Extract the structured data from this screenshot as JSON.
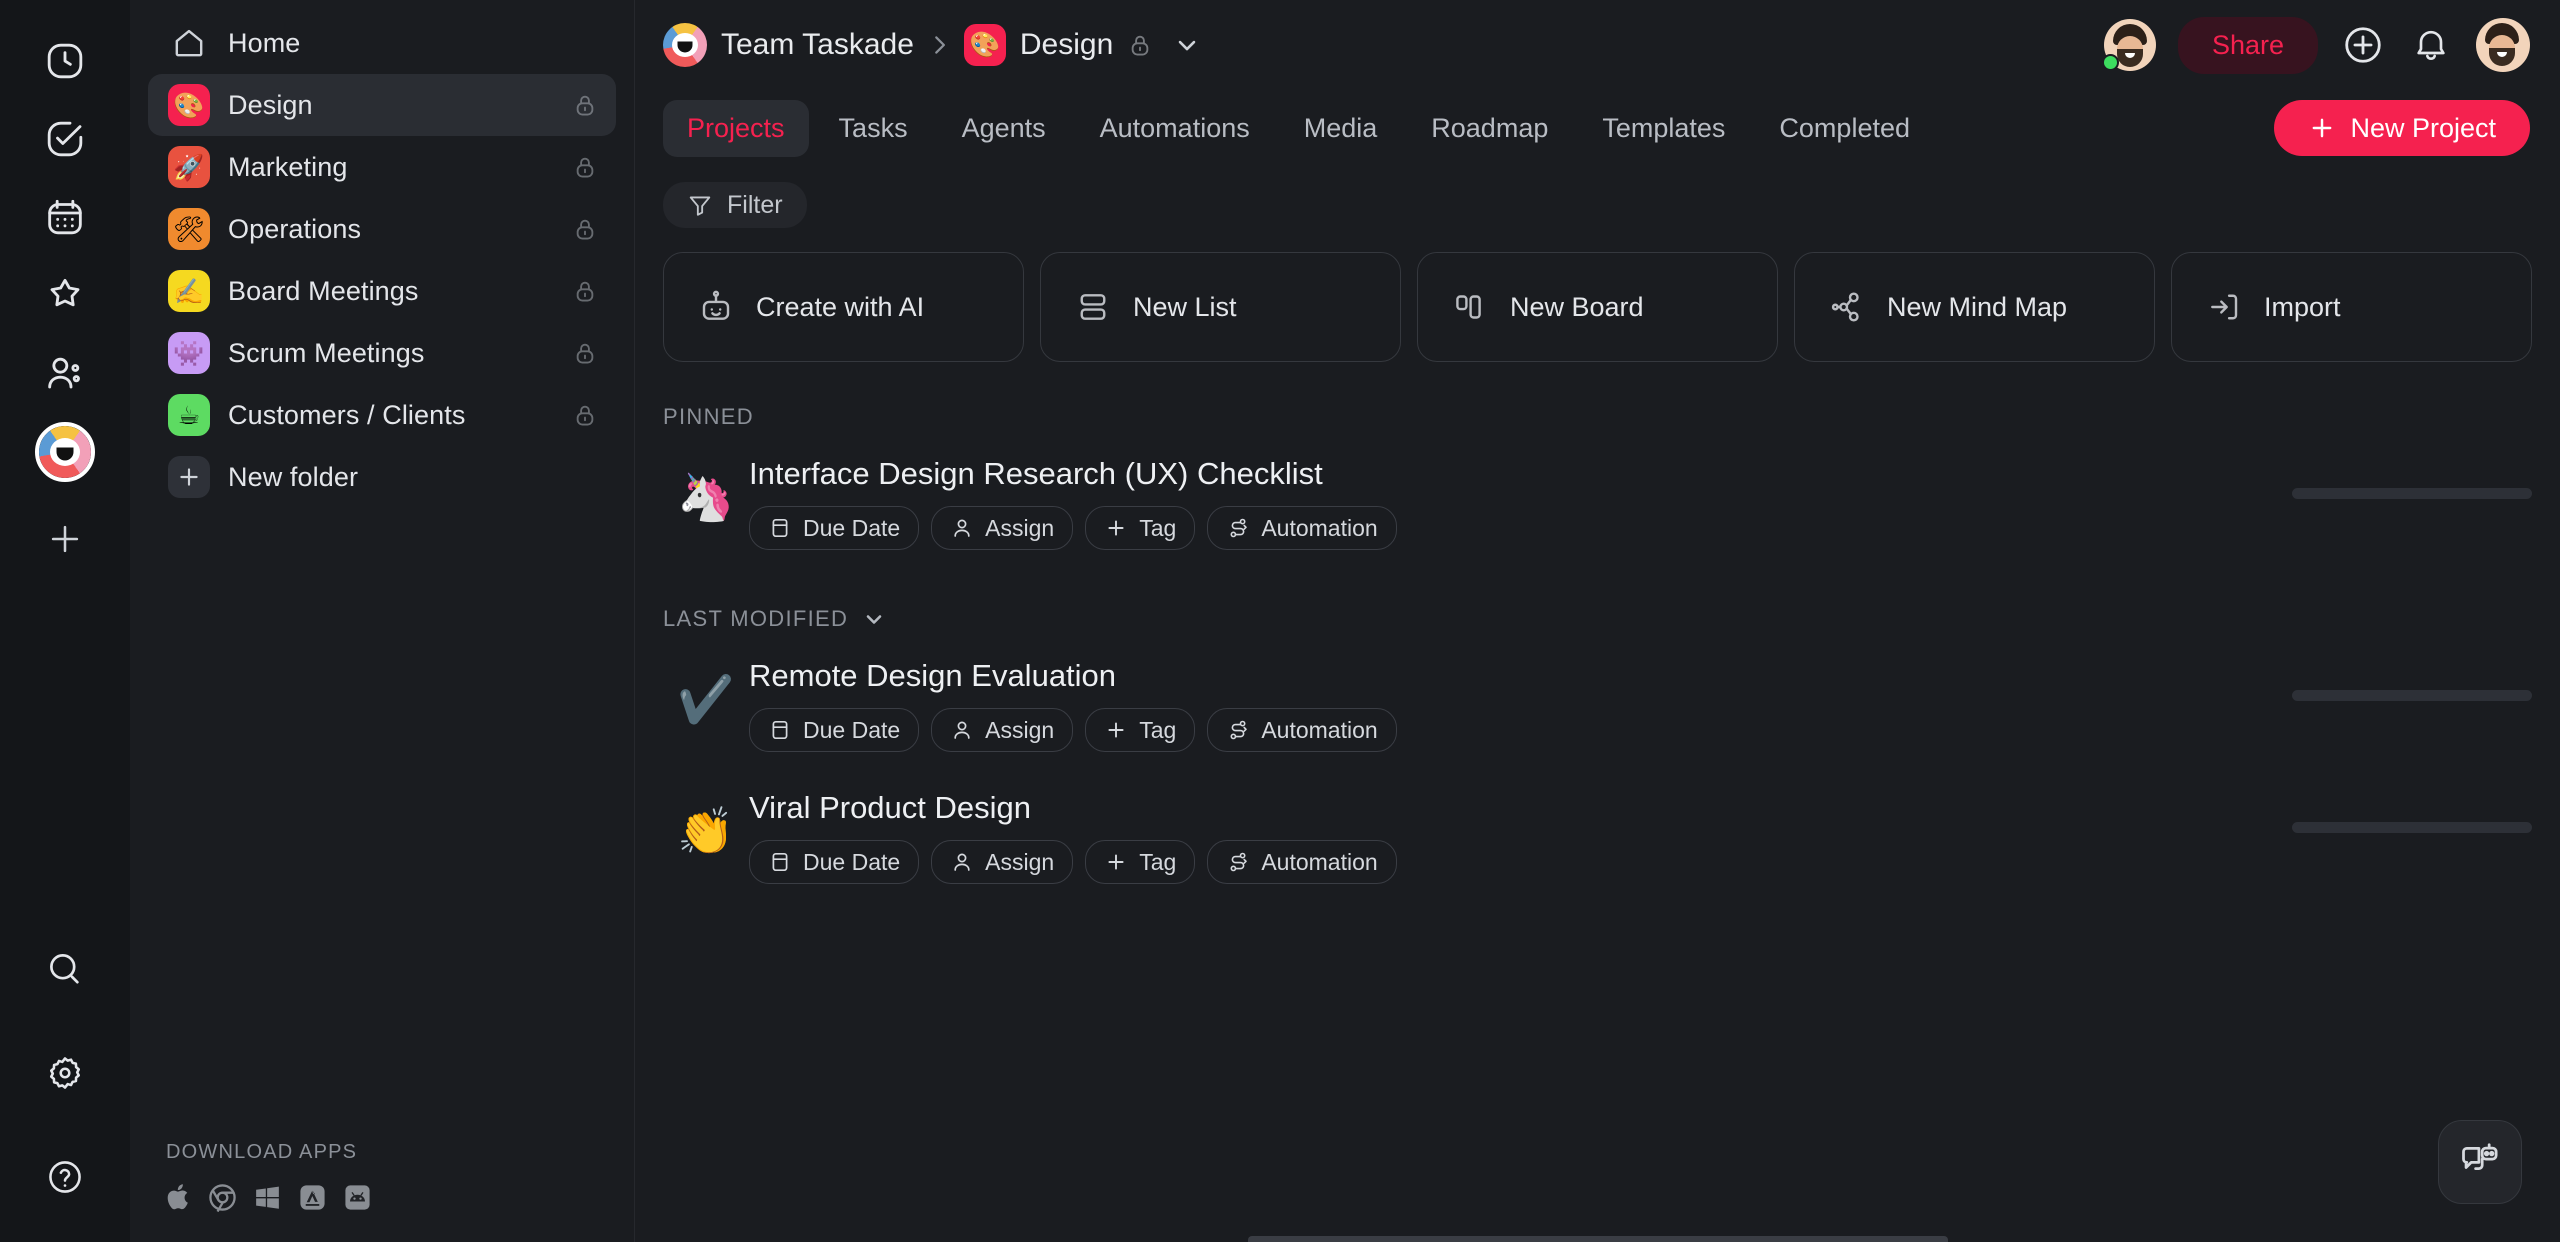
{
  "colors": {
    "accent": "#f5214f",
    "bg": "#1a1c20",
    "rail_bg": "#141619",
    "panel_active": "#2a2d33",
    "text": "#e4e6ea",
    "muted": "#8b9098",
    "online": "#3ddc5f"
  },
  "rail": {
    "items": [
      {
        "name": "recent-icon",
        "label": "Recent"
      },
      {
        "name": "tasks-icon",
        "label": "Tasks"
      },
      {
        "name": "calendar-icon",
        "label": "Calendar"
      },
      {
        "name": "star-icon",
        "label": "Favorites"
      },
      {
        "name": "people-icon",
        "label": "People"
      }
    ],
    "workspace_label": "Team Taskade",
    "add_label": "Add workspace",
    "bottom": [
      {
        "name": "search-icon",
        "label": "Search"
      },
      {
        "name": "gear-icon",
        "label": "Settings"
      },
      {
        "name": "help-icon",
        "label": "Help"
      }
    ]
  },
  "sidebar": {
    "items": [
      {
        "label": "Home",
        "emoji": "",
        "icon": "home-icon",
        "color": "transparent",
        "locked": false,
        "active": false
      },
      {
        "label": "Design",
        "emoji": "🎨",
        "color": "#f5214f",
        "locked": true,
        "active": true
      },
      {
        "label": "Marketing",
        "emoji": "🚀",
        "color": "#e8523f",
        "locked": true,
        "active": false
      },
      {
        "label": "Operations",
        "emoji": "🛠",
        "color": "#f08a2e",
        "locked": true,
        "active": false
      },
      {
        "label": "Board Meetings",
        "emoji": "✍️",
        "color": "#f5d920",
        "locked": true,
        "active": false
      },
      {
        "label": "Scrum Meetings",
        "emoji": "👾",
        "color": "#c79bf5",
        "locked": true,
        "active": false
      },
      {
        "label": "Customers / Clients",
        "emoji": "☕",
        "color": "#5ddb62",
        "locked": true,
        "active": false
      },
      {
        "label": "New folder",
        "emoji": "+",
        "color": "#2e3138",
        "locked": false,
        "active": false
      }
    ],
    "downloads": {
      "title": "DOWNLOAD APPS",
      "icons": [
        {
          "name": "apple-icon",
          "label": "macOS"
        },
        {
          "name": "chrome-icon",
          "label": "Chrome"
        },
        {
          "name": "windows-icon",
          "label": "Windows"
        },
        {
          "name": "appstore-icon",
          "label": "App Store"
        },
        {
          "name": "android-icon",
          "label": "Android"
        }
      ]
    }
  },
  "header": {
    "breadcrumb": {
      "workspace": "Team Taskade",
      "separator": "›",
      "project": "Design",
      "project_emoji": "🎨",
      "project_locked": true
    },
    "share_label": "Share",
    "actions": [
      {
        "name": "add-icon",
        "label": "Add"
      },
      {
        "name": "bell-icon",
        "label": "Notifications"
      }
    ]
  },
  "tabs": {
    "items": [
      {
        "label": "Projects",
        "active": true
      },
      {
        "label": "Tasks",
        "active": false
      },
      {
        "label": "Agents",
        "active": false
      },
      {
        "label": "Automations",
        "active": false
      },
      {
        "label": "Media",
        "active": false
      },
      {
        "label": "Roadmap",
        "active": false
      },
      {
        "label": "Templates",
        "active": false
      },
      {
        "label": "Completed",
        "active": false
      }
    ],
    "new_project_label": "New Project",
    "new_project_plus": "+"
  },
  "toolbar": {
    "filter_label": "Filter"
  },
  "create_cards": [
    {
      "label": "Create with AI",
      "icon": "robot-icon"
    },
    {
      "label": "New List",
      "icon": "list-icon"
    },
    {
      "label": "New Board",
      "icon": "board-icon"
    },
    {
      "label": "New Mind Map",
      "icon": "mindmap-icon"
    },
    {
      "label": "Import",
      "icon": "import-icon"
    }
  ],
  "sections": {
    "pinned": {
      "title": "PINNED",
      "projects": [
        {
          "title": "Interface Design Research (UX) Checklist",
          "emoji": "🦄",
          "chips": [
            {
              "label": "Due Date",
              "icon": "calendar-icon"
            },
            {
              "label": "Assign",
              "icon": "person-icon"
            },
            {
              "label": "Tag",
              "icon": "plus-icon"
            },
            {
              "label": "Automation",
              "icon": "automation-icon"
            }
          ]
        }
      ]
    },
    "last_modified": {
      "title": "LAST MODIFIED",
      "sort_caret": "⌄",
      "projects": [
        {
          "title": "Remote Design Evaluation",
          "emoji": "✔️",
          "chips": [
            {
              "label": "Due Date",
              "icon": "calendar-icon"
            },
            {
              "label": "Assign",
              "icon": "person-icon"
            },
            {
              "label": "Tag",
              "icon": "plus-icon"
            },
            {
              "label": "Automation",
              "icon": "automation-icon"
            }
          ]
        },
        {
          "title": "Viral Product Design",
          "emoji": "👏",
          "chips": [
            {
              "label": "Due Date",
              "icon": "calendar-icon"
            },
            {
              "label": "Assign",
              "icon": "person-icon"
            },
            {
              "label": "Tag",
              "icon": "plus-icon"
            },
            {
              "label": "Automation",
              "icon": "automation-icon"
            }
          ]
        }
      ]
    }
  },
  "chat_widget": {
    "label": "AI Chat",
    "icon": "chat-bot-icon"
  }
}
